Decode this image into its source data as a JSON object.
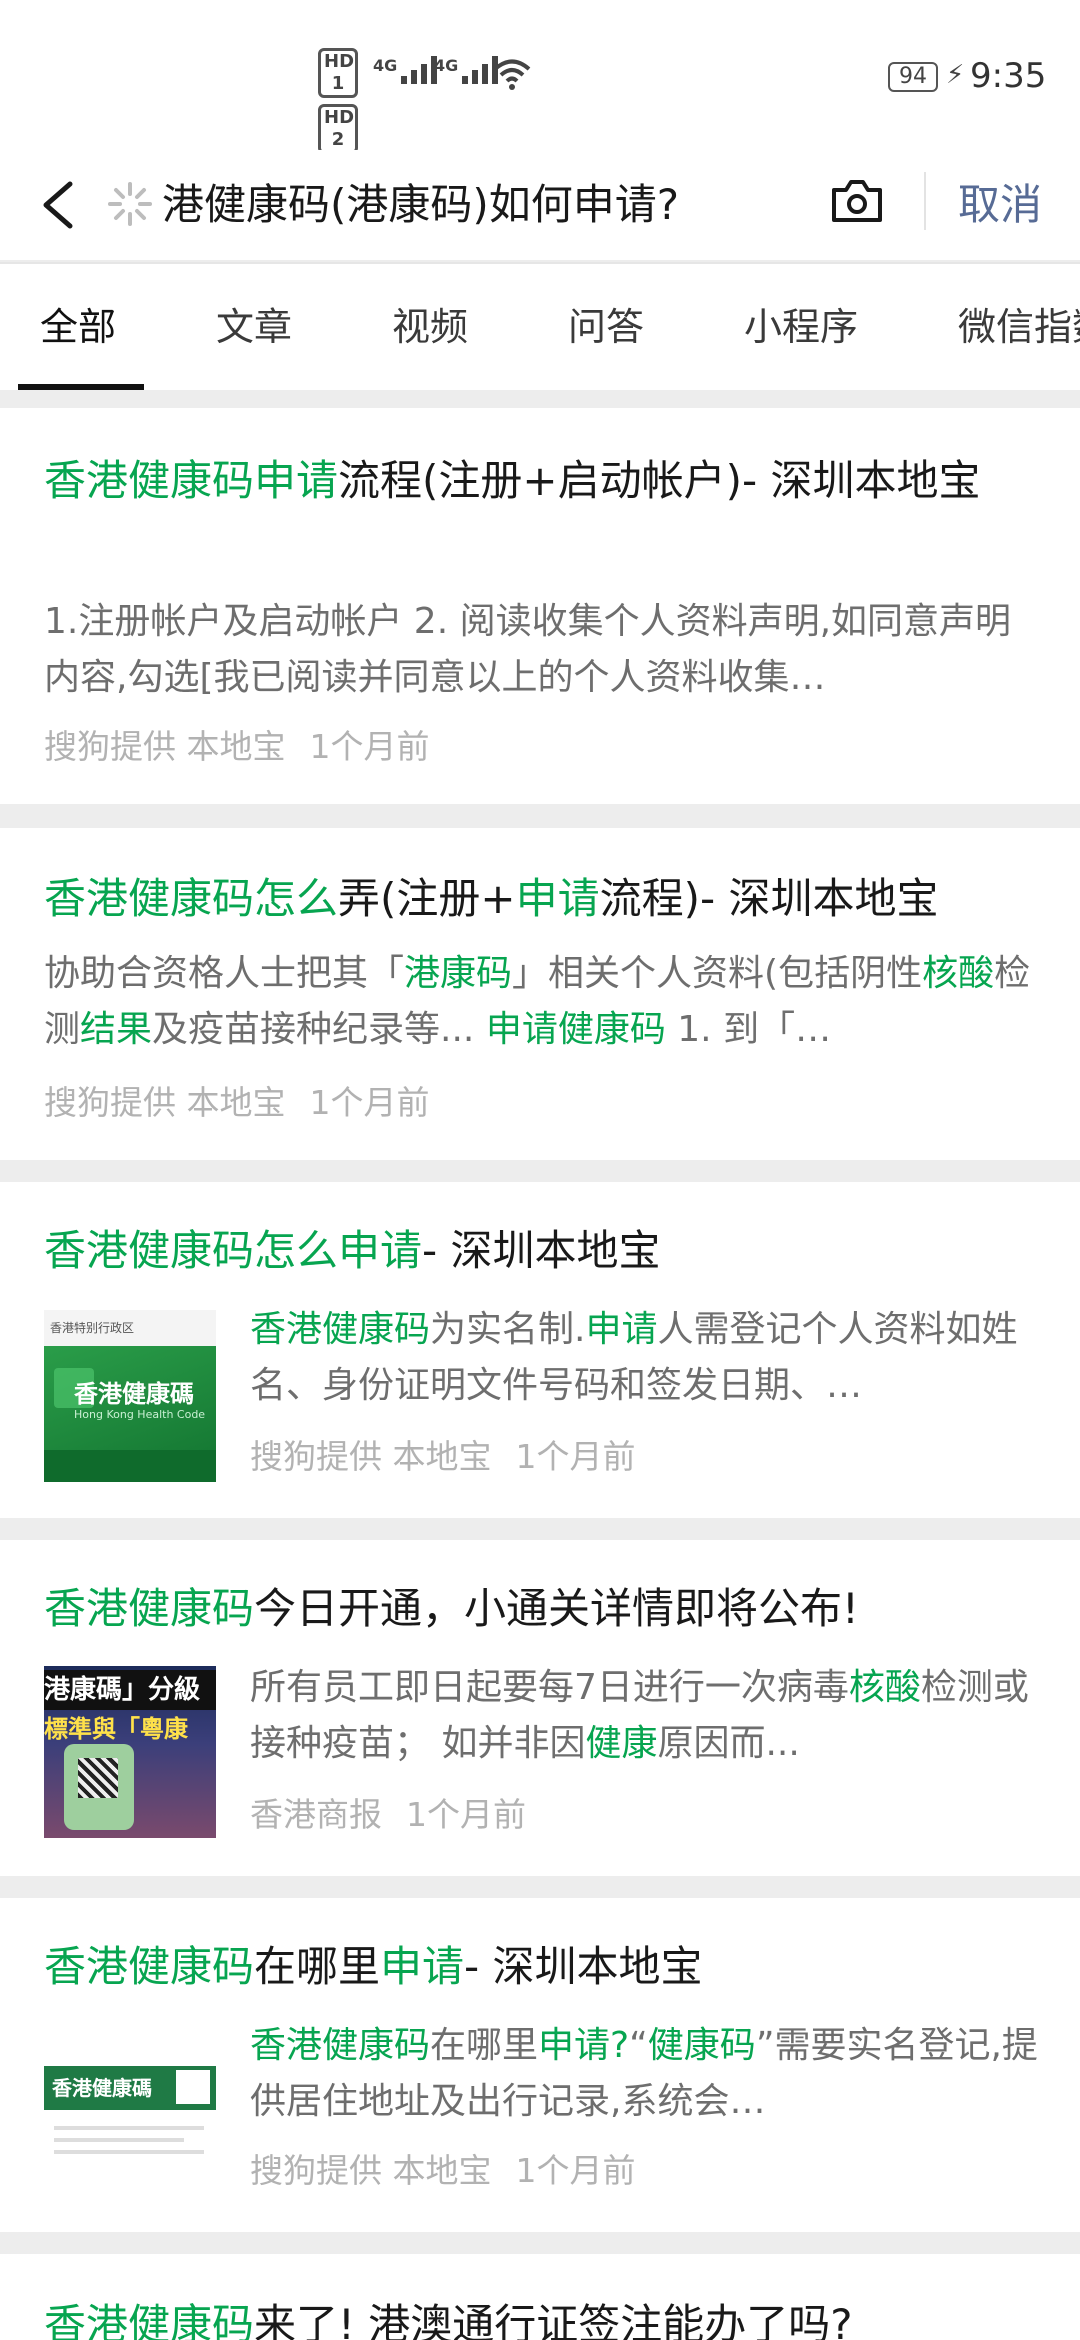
{
  "status_bar": {
    "hd1": "HD 1",
    "hd2": "HD 2",
    "net1": "4G",
    "net2": "4G",
    "battery": "94",
    "time": "9:35"
  },
  "search": {
    "query": "港健康码(港康码)如何申请?",
    "cancel_label": "取消"
  },
  "tabs": [
    "全部",
    "文章",
    "视频",
    "问答",
    "小程序",
    "微信指数"
  ],
  "results": [
    {
      "title": [
        {
          "t": "香港健康码申请",
          "h": true
        },
        {
          "t": "流程(注册+启动帐户)- 深圳本地宝",
          "h": false
        }
      ],
      "snippet": [
        {
          "t": "1.注册帐户及启动帐户 2. 阅读收集个人资料声明,如同意声明内容,勾选[我已阅读并同意以上的个人资料收集…",
          "h": false
        }
      ],
      "source": "搜狗提供 本地宝",
      "time": "1个月前"
    },
    {
      "title": [
        {
          "t": "香港健康码怎么",
          "h": true
        },
        {
          "t": "弄(注册+",
          "h": false
        },
        {
          "t": "申请",
          "h": true
        },
        {
          "t": "流程)- 深圳本地宝",
          "h": false
        }
      ],
      "snippet": [
        {
          "t": "协助合资格人士把其「",
          "h": false
        },
        {
          "t": "港康码",
          "h": true
        },
        {
          "t": "」相关个人资料(包括阴性",
          "h": false
        },
        {
          "t": "核酸",
          "h": true
        },
        {
          "t": "检测",
          "h": false
        },
        {
          "t": "结果",
          "h": true
        },
        {
          "t": "及疫苗接种纪录等... ",
          "h": false
        },
        {
          "t": "申请健康码",
          "h": true
        },
        {
          "t": " 1. 到「…",
          "h": false
        }
      ],
      "source": "搜狗提供 本地宝",
      "time": "1个月前"
    },
    {
      "title": [
        {
          "t": "香港健康码怎么申请",
          "h": true
        },
        {
          "t": "- 深圳本地宝",
          "h": false
        }
      ],
      "snippet": [
        {
          "t": "香港健康码",
          "h": true
        },
        {
          "t": "为实名制.",
          "h": false
        },
        {
          "t": "申请",
          "h": true
        },
        {
          "t": "人需登记个人资料如姓名、身份证明文件号码和签发日期、…",
          "h": false
        }
      ],
      "source": "搜狗提供 本地宝",
      "time": "1个月前",
      "thumb": {
        "head": "香港特别行政区",
        "big": "香港健康碼",
        "en": "Hong Kong Health Code"
      }
    },
    {
      "title": [
        {
          "t": "香港健康码",
          "h": true
        },
        {
          "t": "今日开通，小通关详情即将公布!",
          "h": false
        }
      ],
      "snippet": [
        {
          "t": "所有员工即日起要每7日进行一次病毒",
          "h": false
        },
        {
          "t": "核酸",
          "h": true
        },
        {
          "t": "检测或接种疫苗；  如并非因",
          "h": false
        },
        {
          "t": "健康",
          "h": true
        },
        {
          "t": "原因而...",
          "h": false
        }
      ],
      "source": "香港商报",
      "time": "1个月前",
      "thumb": {
        "big": "港康碼」分級",
        "en": "標準與「粵康"
      }
    },
    {
      "title": [
        {
          "t": "香港健康码",
          "h": true
        },
        {
          "t": "在哪里",
          "h": false
        },
        {
          "t": "申请",
          "h": true
        },
        {
          "t": "- 深圳本地宝",
          "h": false
        }
      ],
      "snippet": [
        {
          "t": "香港健康码",
          "h": true
        },
        {
          "t": "在哪里",
          "h": false
        },
        {
          "t": "申请?",
          "h": true
        },
        {
          "t": "“",
          "h": false
        },
        {
          "t": "健康码",
          "h": true
        },
        {
          "t": "”需要实名登记,提供居住地址及出行记录,系统会…",
          "h": false
        }
      ],
      "source": "搜狗提供 本地宝",
      "time": "1个月前",
      "thumb": {
        "big": "香港健康碼"
      }
    },
    {
      "title": [
        {
          "t": "香港健康码",
          "h": true
        },
        {
          "t": "来了! 港澳通行证签注能办了吗?",
          "h": false
        }
      ]
    }
  ]
}
